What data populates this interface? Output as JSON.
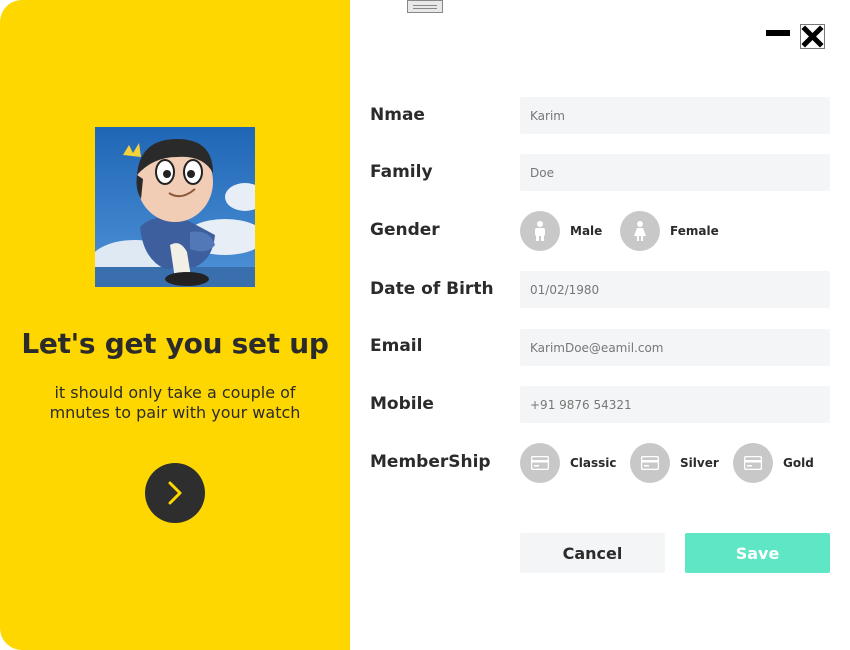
{
  "left_panel": {
    "headline": "Let's get you set up",
    "subtext": "it should only take a couple of mnutes to pair with your watch",
    "next_icon": "chevron-right-icon",
    "background_color": "#FED700"
  },
  "window_controls": {
    "minimize_icon": "minimize-icon",
    "close_icon": "close-icon"
  },
  "form": {
    "name": {
      "label": "Nmae",
      "value": "Karim"
    },
    "family": {
      "label": "Family",
      "value": "Doe"
    },
    "gender": {
      "label": "Gender",
      "options": [
        "Male",
        "Female"
      ]
    },
    "dob": {
      "label": "Date of Birth",
      "value": "01/02/1980"
    },
    "email": {
      "label": "Email",
      "value": "KarimDoe@eamil.com"
    },
    "mobile": {
      "label": "Mobile",
      "value": "+91 9876 54321"
    },
    "membership": {
      "label": "MemberShip",
      "options": [
        "Classic",
        "Silver",
        "Gold"
      ]
    }
  },
  "actions": {
    "cancel_label": "Cancel",
    "save_label": "Save",
    "save_color": "#5fe6c4"
  }
}
